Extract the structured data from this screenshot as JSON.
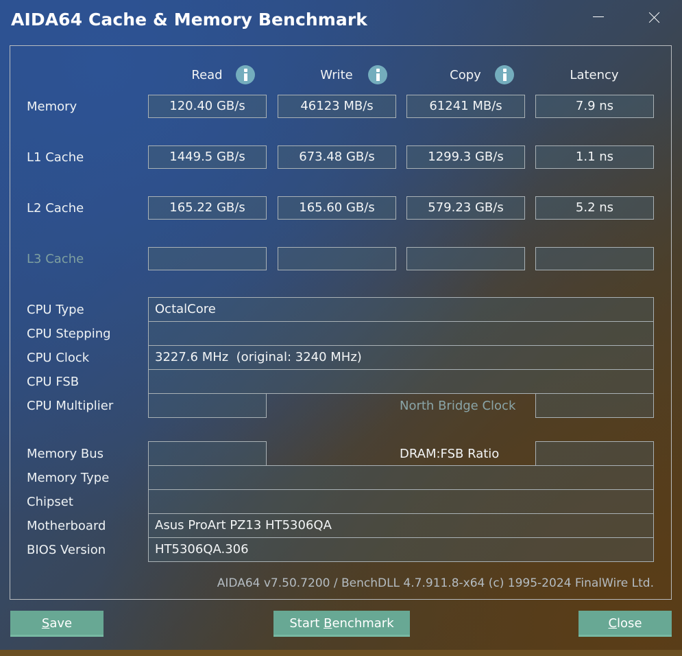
{
  "window": {
    "title": "AIDA64 Cache & Memory Benchmark",
    "controls": {
      "minimize": "minimize-icon",
      "close": "close-icon"
    }
  },
  "columns": [
    {
      "label": "Read",
      "info_icon": true
    },
    {
      "label": "Write",
      "info_icon": true
    },
    {
      "label": "Copy",
      "info_icon": true
    },
    {
      "label": "Latency",
      "info_icon": false
    }
  ],
  "benchmarks": [
    {
      "label": "Memory",
      "enabled": true,
      "read": "120.40 GB/s",
      "write": "46123 MB/s",
      "copy": "61241 MB/s",
      "latency": "7.9 ns"
    },
    {
      "label": "L1 Cache",
      "enabled": true,
      "read": "1449.5 GB/s",
      "write": "673.48 GB/s",
      "copy": "1299.3 GB/s",
      "latency": "1.1 ns"
    },
    {
      "label": "L2 Cache",
      "enabled": true,
      "read": "165.22 GB/s",
      "write": "165.60 GB/s",
      "copy": "579.23 GB/s",
      "latency": "5.2 ns"
    },
    {
      "label": "L3 Cache",
      "enabled": false,
      "read": "",
      "write": "",
      "copy": "",
      "latency": ""
    }
  ],
  "cpu_info": {
    "cpu_type": {
      "label": "CPU Type",
      "value": "OctalCore"
    },
    "cpu_stepping": {
      "label": "CPU Stepping",
      "value": ""
    },
    "cpu_clock": {
      "label": "CPU Clock",
      "value": "3227.6 MHz  (original: 3240 MHz)"
    },
    "cpu_fsb": {
      "label": "CPU FSB",
      "value": ""
    },
    "cpu_multiplier": {
      "label": "CPU Multiplier",
      "value": ""
    },
    "north_bridge_clock": {
      "label": "North Bridge Clock",
      "value": ""
    }
  },
  "memory_info": {
    "memory_bus": {
      "label": "Memory Bus",
      "value": ""
    },
    "dram_fsb_ratio": {
      "label": "DRAM:FSB Ratio",
      "value": ""
    },
    "memory_type": {
      "label": "Memory Type",
      "value": ""
    },
    "chipset": {
      "label": "Chipset",
      "value": ""
    },
    "motherboard": {
      "label": "Motherboard",
      "value": "Asus ProArt PZ13 HT5306QA"
    },
    "bios_version": {
      "label": "BIOS Version",
      "value": "HT5306QA.306"
    }
  },
  "footer": {
    "version_text": "AIDA64 v7.50.7200 / BenchDLL 4.7.911.8-x64  (c) 1995-2024 FinalWire Ltd."
  },
  "buttons": {
    "save": {
      "accel": "S",
      "rest": "ave"
    },
    "start": {
      "pre": "Start ",
      "accel": "B",
      "rest": "enchmark"
    },
    "close": {
      "accel": "C",
      "rest": "lose"
    }
  },
  "colors": {
    "button_bg": "#68a894",
    "info_icon": "#74adbd",
    "disabled_label": "#7fa0a0",
    "border": "#aab2b6"
  }
}
